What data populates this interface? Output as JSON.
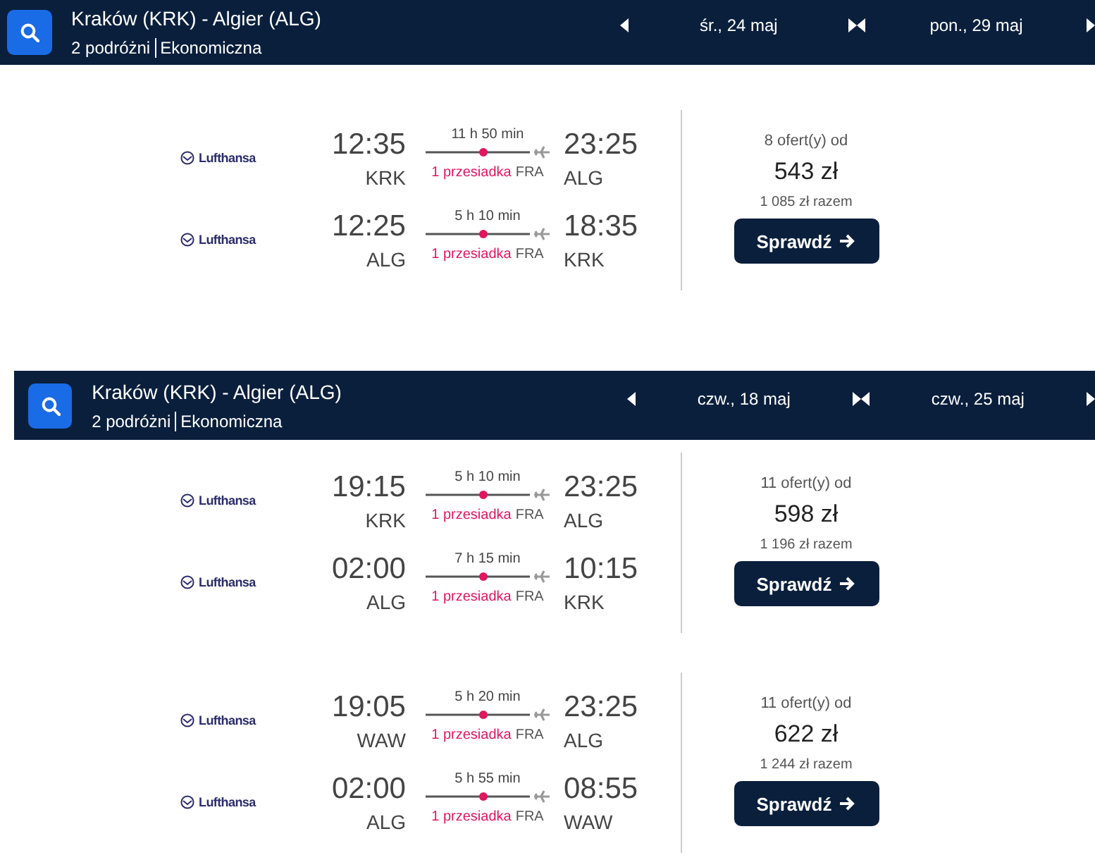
{
  "searches": [
    {
      "route": "Kraków (KRK) - Algier (ALG)",
      "travelers": "2 podróżni",
      "cabin": "Ekonomiczna",
      "dates": [
        "śr., 24 maj",
        "pon., 29 maj"
      ],
      "results": [
        {
          "offers": "8 ofert(y) od",
          "price": "543 zł",
          "total": "1 085 zł razem",
          "button": "Sprawdź",
          "legs": [
            {
              "airline": "Lufthansa",
              "dep_time": "12:35",
              "dep_code": "KRK",
              "duration": "11 h 50 min",
              "stops": "1 przesiadka",
              "via": "FRA",
              "arr_time": "23:25",
              "arr_code": "ALG"
            },
            {
              "airline": "Lufthansa",
              "dep_time": "12:25",
              "dep_code": "ALG",
              "duration": "5 h 10 min",
              "stops": "1 przesiadka",
              "via": "FRA",
              "arr_time": "18:35",
              "arr_code": "KRK"
            }
          ]
        }
      ]
    },
    {
      "route": "Kraków (KRK) - Algier (ALG)",
      "travelers": "2 podróżni",
      "cabin": "Ekonomiczna",
      "dates": [
        "czw., 18 maj",
        "czw., 25 maj"
      ],
      "results": [
        {
          "offers": "11 ofert(y) od",
          "price": "598 zł",
          "total": "1 196 zł razem",
          "button": "Sprawdź",
          "legs": [
            {
              "airline": "Lufthansa",
              "dep_time": "19:15",
              "dep_code": "KRK",
              "duration": "5 h 10 min",
              "stops": "1 przesiadka",
              "via": "FRA",
              "arr_time": "23:25",
              "arr_code": "ALG"
            },
            {
              "airline": "Lufthansa",
              "dep_time": "02:00",
              "dep_code": "ALG",
              "duration": "7 h 15 min",
              "stops": "1 przesiadka",
              "via": "FRA",
              "arr_time": "10:15",
              "arr_code": "KRK"
            }
          ]
        },
        {
          "offers": "11 ofert(y) od",
          "price": "622 zł",
          "total": "1 244 zł razem",
          "button": "Sprawdź",
          "legs": [
            {
              "airline": "Lufthansa",
              "dep_time": "19:05",
              "dep_code": "WAW",
              "duration": "5 h 20 min",
              "stops": "1 przesiadka",
              "via": "FRA",
              "arr_time": "23:25",
              "arr_code": "ALG"
            },
            {
              "airline": "Lufthansa",
              "dep_time": "02:00",
              "dep_code": "ALG",
              "duration": "5 h 55 min",
              "stops": "1 przesiadka",
              "via": "FRA",
              "arr_time": "08:55",
              "arr_code": "WAW"
            }
          ]
        }
      ]
    }
  ]
}
